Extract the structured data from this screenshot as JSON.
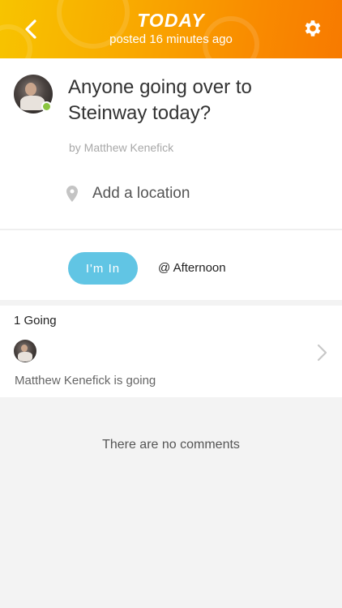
{
  "header": {
    "title": "TODAY",
    "subtitle": "posted 16 minutes ago"
  },
  "post": {
    "title": "Anyone going over to Steinway today?",
    "author": "by Matthew Kenefick",
    "location_label": "Add a location",
    "online_color": "#8bc53f"
  },
  "rsvp": {
    "button_label": "I'm In",
    "time_label": "@ Afternoon",
    "accent_color": "#61c5e4"
  },
  "going": {
    "count_label": "1 Going",
    "summary": "Matthew Kenefick is going"
  },
  "comments": {
    "empty_text": "There are no comments"
  },
  "icons": {
    "back": "chevron-left-icon",
    "settings": "gear-icon",
    "location": "map-pin-icon",
    "more": "chevron-right-icon"
  }
}
